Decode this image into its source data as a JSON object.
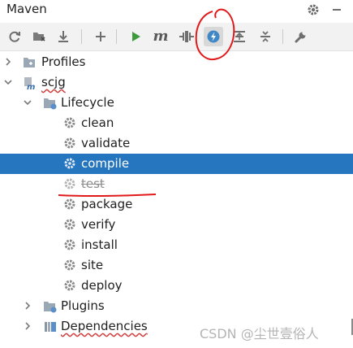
{
  "window": {
    "title": "Maven"
  },
  "title_actions": [
    {
      "icon": "gear-icon"
    },
    {
      "icon": "minimize-icon"
    }
  ],
  "toolbar": {
    "buttons": [
      {
        "icon": "reload-icon"
      },
      {
        "icon": "generate-sources-icon"
      },
      {
        "icon": "download-icon"
      },
      {
        "icon": "add-icon"
      },
      {
        "icon": "run-icon"
      },
      {
        "icon": "maven-goal-icon",
        "glyph": "m"
      },
      {
        "icon": "toggle-offline-icon"
      },
      {
        "icon": "skip-tests-icon",
        "state": "active"
      },
      {
        "icon": "show-dependencies-icon"
      },
      {
        "icon": "collapse-all-icon"
      },
      {
        "icon": "settings-wrench-icon"
      }
    ]
  },
  "tree": {
    "profiles": {
      "label": "Profiles"
    },
    "project": {
      "label": "scjg"
    },
    "lifecycle": {
      "label": "Lifecycle",
      "goals": [
        {
          "label": "clean"
        },
        {
          "label": "validate"
        },
        {
          "label": "compile",
          "state": "selected"
        },
        {
          "label": "test",
          "state": "skipped"
        },
        {
          "label": "package"
        },
        {
          "label": "verify"
        },
        {
          "label": "install"
        },
        {
          "label": "site"
        },
        {
          "label": "deploy"
        }
      ]
    },
    "plugins": {
      "label": "Plugins"
    },
    "dependencies": {
      "label": "Dependencies"
    }
  },
  "watermark": "CSDN @尘世壹俗人",
  "colors": {
    "selection": "#2675bf",
    "annotation": "#e01a1a",
    "icon_gray": "#6e6e6e",
    "run_green": "#3d9a3d",
    "folder_blue": "#5b8fc9"
  }
}
